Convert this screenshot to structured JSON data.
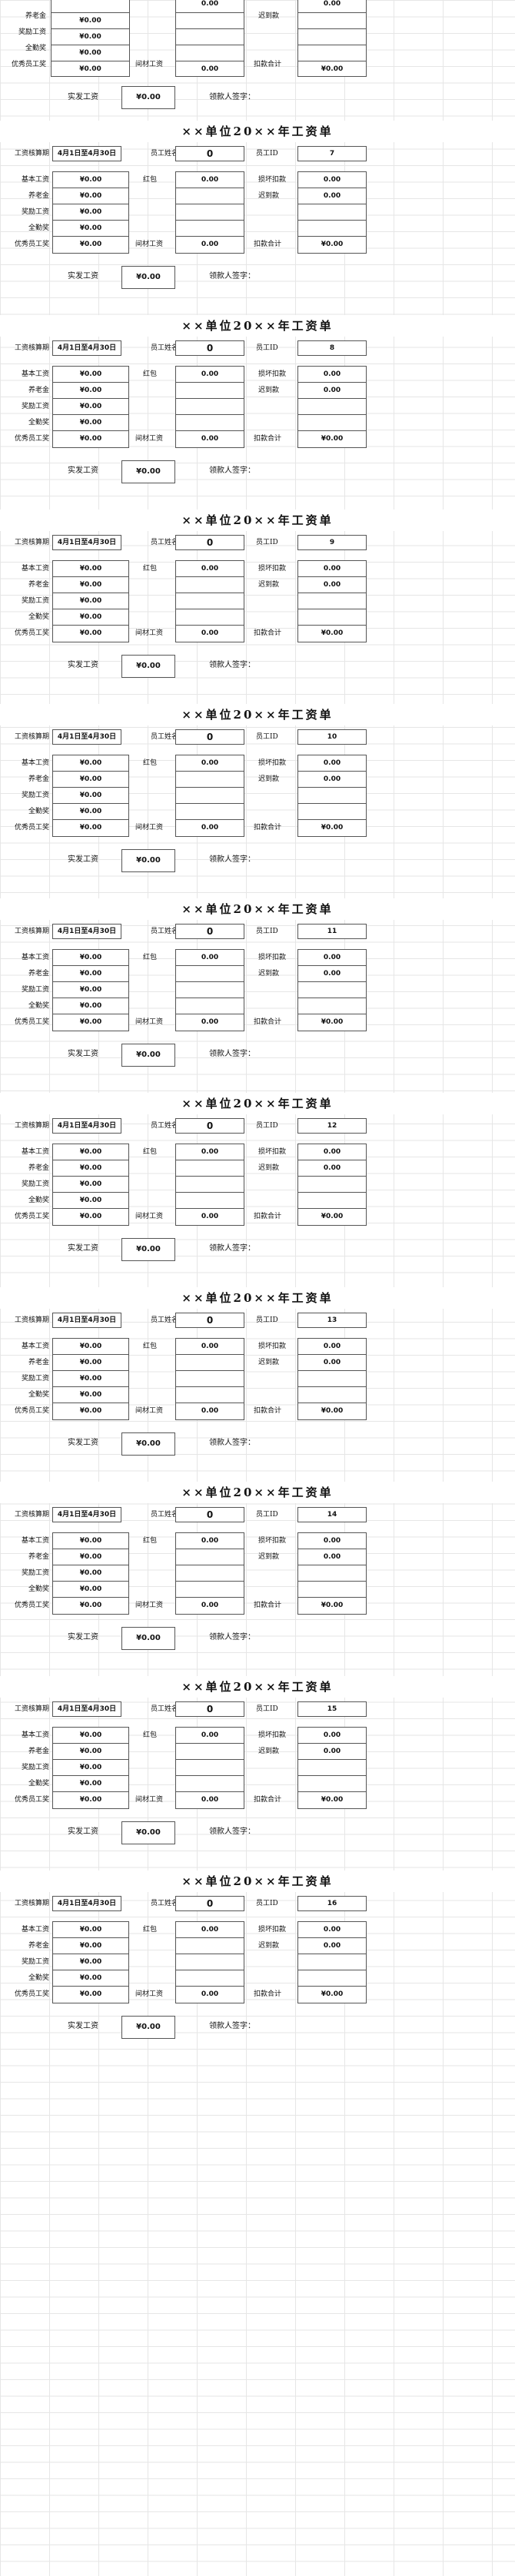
{
  "labels": {
    "title": "××单位20××年工资单",
    "pay_period": "工资核算期",
    "name": "员工姓名",
    "emp_id": "员工ID",
    "base_pay": "基本工资",
    "pension": "养老金",
    "bonus": "奖励工资",
    "attendance": "全勤奖",
    "excellent": "优秀员工奖",
    "commission": "红包",
    "material_bonus": "间材工资",
    "deductions_items": "损坏扣款",
    "fines": "迟到款",
    "total_deductions": "扣款合计",
    "net_pay": "实发工资",
    "signature": "领款人签字："
  },
  "partial_top": {
    "pension": "¥0.00",
    "bonus": "¥0.00",
    "attendance": "¥0.00",
    "excellent": "¥0.00",
    "commission_value": "0.00",
    "deduction_value": "0.00",
    "material": "0.00",
    "total": "¥0.00",
    "net": "¥0.00"
  },
  "slips": [
    {
      "period": "4月1日至4月30日",
      "name_value": "0",
      "emp_id": "7",
      "base": "¥0.00",
      "pension": "¥0.00",
      "bonus": "¥0.00",
      "attendance": "¥0.00",
      "excellent": "¥0.00",
      "commission": "0.00",
      "material": "0.00",
      "deduction1": "0.00",
      "deduction2": "0.00",
      "total": "¥0.00",
      "net": "¥0.00"
    },
    {
      "period": "4月1日至4月30日",
      "name_value": "0",
      "emp_id": "8",
      "base": "¥0.00",
      "pension": "¥0.00",
      "bonus": "¥0.00",
      "attendance": "¥0.00",
      "excellent": "¥0.00",
      "commission": "0.00",
      "material": "0.00",
      "deduction1": "0.00",
      "deduction2": "0.00",
      "total": "¥0.00",
      "net": "¥0.00"
    },
    {
      "period": "4月1日至4月30日",
      "name_value": "0",
      "emp_id": "9",
      "base": "¥0.00",
      "pension": "¥0.00",
      "bonus": "¥0.00",
      "attendance": "¥0.00",
      "excellent": "¥0.00",
      "commission": "0.00",
      "material": "0.00",
      "deduction1": "0.00",
      "deduction2": "0.00",
      "total": "¥0.00",
      "net": "¥0.00"
    },
    {
      "period": "4月1日至4月30日",
      "name_value": "0",
      "emp_id": "10",
      "base": "¥0.00",
      "pension": "¥0.00",
      "bonus": "¥0.00",
      "attendance": "¥0.00",
      "excellent": "¥0.00",
      "commission": "0.00",
      "material": "0.00",
      "deduction1": "0.00",
      "deduction2": "0.00",
      "total": "¥0.00",
      "net": "¥0.00"
    },
    {
      "period": "4月1日至4月30日",
      "name_value": "0",
      "emp_id": "11",
      "base": "¥0.00",
      "pension": "¥0.00",
      "bonus": "¥0.00",
      "attendance": "¥0.00",
      "excellent": "¥0.00",
      "commission": "0.00",
      "material": "0.00",
      "deduction1": "0.00",
      "deduction2": "0.00",
      "total": "¥0.00",
      "net": "¥0.00"
    },
    {
      "period": "4月1日至4月30日",
      "name_value": "0",
      "emp_id": "12",
      "base": "¥0.00",
      "pension": "¥0.00",
      "bonus": "¥0.00",
      "attendance": "¥0.00",
      "excellent": "¥0.00",
      "commission": "0.00",
      "material": "0.00",
      "deduction1": "0.00",
      "deduction2": "0.00",
      "total": "¥0.00",
      "net": "¥0.00"
    },
    {
      "period": "4月1日至4月30日",
      "name_value": "0",
      "emp_id": "13",
      "base": "¥0.00",
      "pension": "¥0.00",
      "bonus": "¥0.00",
      "attendance": "¥0.00",
      "excellent": "¥0.00",
      "commission": "0.00",
      "material": "0.00",
      "deduction1": "0.00",
      "deduction2": "0.00",
      "total": "¥0.00",
      "net": "¥0.00"
    },
    {
      "period": "4月1日至4月30日",
      "name_value": "0",
      "emp_id": "14",
      "base": "¥0.00",
      "pension": "¥0.00",
      "bonus": "¥0.00",
      "attendance": "¥0.00",
      "excellent": "¥0.00",
      "commission": "0.00",
      "material": "0.00",
      "deduction1": "0.00",
      "deduction2": "0.00",
      "total": "¥0.00",
      "net": "¥0.00"
    },
    {
      "period": "4月1日至4月30日",
      "name_value": "0",
      "emp_id": "15",
      "base": "¥0.00",
      "pension": "¥0.00",
      "bonus": "¥0.00",
      "attendance": "¥0.00",
      "excellent": "¥0.00",
      "commission": "0.00",
      "material": "0.00",
      "deduction1": "0.00",
      "deduction2": "0.00",
      "total": "¥0.00",
      "net": "¥0.00"
    },
    {
      "period": "4月1日至4月30日",
      "name_value": "0",
      "emp_id": "16",
      "base": "¥0.00",
      "pension": "¥0.00",
      "bonus": "¥0.00",
      "attendance": "¥0.00",
      "excellent": "¥0.00",
      "commission": "0.00",
      "material": "0.00",
      "deduction1": "0.00",
      "deduction2": "0.00",
      "total": "¥0.00",
      "net": "¥0.00"
    }
  ]
}
